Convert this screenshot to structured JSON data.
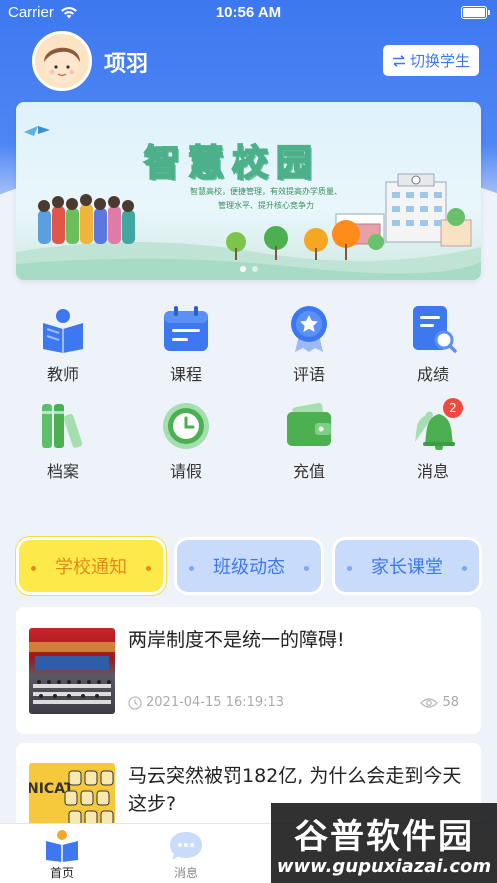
{
  "status_bar": {
    "carrier": "Carrier",
    "time": "10:56 AM"
  },
  "profile": {
    "name": "项羽",
    "switch_label": "切换学生"
  },
  "banner": {
    "title": "智慧校园",
    "subtitle_line1": "智慧高校，便捷管理，有效提高办学质量、",
    "subtitle_line2": "管理水平、提升核心竞争力",
    "active_slide": 1,
    "slide_count": 2
  },
  "menu": [
    {
      "label": "教师",
      "icon": "teacher-book-icon"
    },
    {
      "label": "课程",
      "icon": "calendar-icon"
    },
    {
      "label": "评语",
      "icon": "medal-icon"
    },
    {
      "label": "成绩",
      "icon": "report-search-icon"
    },
    {
      "label": "档案",
      "icon": "books-icon"
    },
    {
      "label": "请假",
      "icon": "clock-icon"
    },
    {
      "label": "充值",
      "icon": "wallet-icon"
    },
    {
      "label": "消息",
      "icon": "bell-icon",
      "badge": "2"
    }
  ],
  "tabs": [
    {
      "label": "学校通知",
      "active": true
    },
    {
      "label": "班级动态",
      "active": false
    },
    {
      "label": "家长课堂",
      "active": false
    }
  ],
  "news": [
    {
      "title": "两岸制度不是统一的障碍!",
      "time": "2021-04-15 16:19:13",
      "views": "58"
    },
    {
      "title": "马云突然被罚182亿, 为什么会走到今天这步?"
    }
  ],
  "tabbar": [
    {
      "label": "首页",
      "icon": "home-book-icon",
      "active": true
    },
    {
      "label": "消息",
      "icon": "chat-bubble-icon",
      "active": false
    }
  ],
  "watermark": {
    "title": "谷普软件园",
    "url": "www.gupuxiazai.com"
  },
  "colors": {
    "primary": "#3d78f0",
    "accent_yellow": "#fde94a",
    "badge_red": "#f04a3c"
  }
}
